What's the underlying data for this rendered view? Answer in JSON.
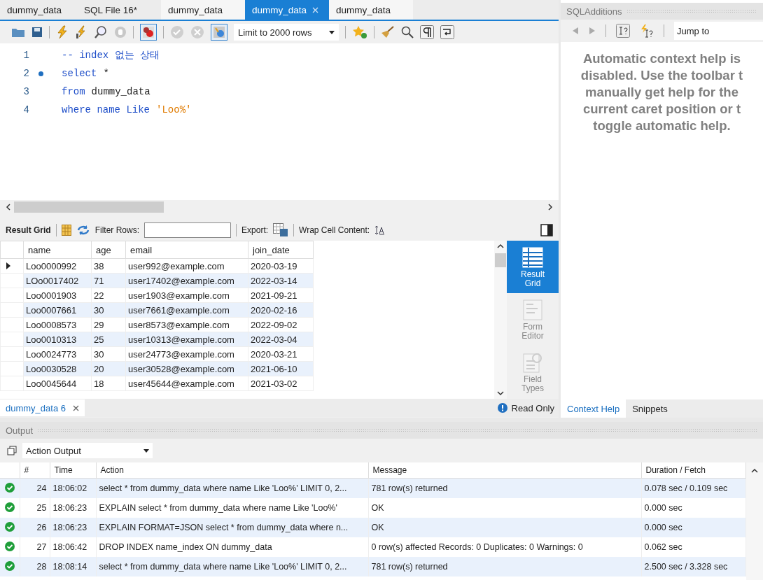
{
  "editor_tabs": [
    {
      "label": "dummy_data",
      "selected": false
    },
    {
      "label": "SQL File 16*",
      "selected": false
    },
    {
      "label": "dummy_data",
      "selected": false
    },
    {
      "label": "dummy_data",
      "selected": true
    },
    {
      "label": "dummy_data",
      "selected": false
    }
  ],
  "toolbar": {
    "limit": "Limit to 2000 rows"
  },
  "editor": {
    "lines": [
      {
        "number": "1",
        "current": false,
        "tokens": [
          {
            "kind": "comment",
            "text": "-- index 없는 상태"
          }
        ]
      },
      {
        "number": "2",
        "current": true,
        "tokens": [
          {
            "kind": "keyword",
            "text": "select"
          },
          {
            "kind": "plain",
            "text": "*"
          }
        ]
      },
      {
        "number": "3",
        "current": false,
        "tokens": [
          {
            "kind": "keyword",
            "text": "from"
          },
          {
            "kind": "plain",
            "text": "dummy_data"
          }
        ]
      },
      {
        "number": "4",
        "current": false,
        "tokens": [
          {
            "kind": "keyword",
            "text": "where name Like"
          },
          {
            "kind": "string",
            "text": "'Loo%'"
          }
        ]
      }
    ]
  },
  "result_toolbar": {
    "grid_label": "Result Grid",
    "filter_label": "Filter Rows:",
    "export_label": "Export:",
    "wrap_label": "Wrap Cell Content:"
  },
  "grid": {
    "columns": [
      "name",
      "age",
      "email",
      "join_date"
    ],
    "rows": [
      {
        "selected": true,
        "cells": [
          "Loo0000992",
          "38",
          "user992@example.com",
          "2020-03-19"
        ]
      },
      {
        "selected": false,
        "cells": [
          "LOo0017402",
          "71",
          "user17402@example.com",
          "2022-03-14"
        ]
      },
      {
        "selected": false,
        "cells": [
          "Loo0001903",
          "22",
          "user1903@example.com",
          "2021-09-21"
        ]
      },
      {
        "selected": false,
        "cells": [
          "Loo0007661",
          "30",
          "user7661@example.com",
          "2020-02-16"
        ]
      },
      {
        "selected": false,
        "cells": [
          "Loo0008573",
          "29",
          "user8573@example.com",
          "2022-09-02"
        ]
      },
      {
        "selected": false,
        "cells": [
          "Loo0010313",
          "25",
          "user10313@example.com",
          "2022-03-04"
        ]
      },
      {
        "selected": false,
        "cells": [
          "Loo0024773",
          "30",
          "user24773@example.com",
          "2020-03-21"
        ]
      },
      {
        "selected": false,
        "cells": [
          "Loo0030528",
          "20",
          "user30528@example.com",
          "2021-06-10"
        ]
      },
      {
        "selected": false,
        "cells": [
          "Loo0045644",
          "18",
          "user45644@example.com",
          "2021-03-02"
        ]
      }
    ]
  },
  "view_panel": [
    {
      "label": "Result Grid",
      "kind": "grid",
      "selected": true
    },
    {
      "label": "Form Editor",
      "kind": "form",
      "selected": false
    },
    {
      "label": "Field Types",
      "kind": "types",
      "selected": false
    }
  ],
  "result_tab": {
    "label": "dummy_data 6",
    "status": "Read Only"
  },
  "sql_additions": {
    "title": "SQLAdditions",
    "jump": "Jump to",
    "help_lines": [
      "Automatic context help is",
      "disabled. Use the toolbar t",
      "manually get help for the",
      "current caret position or t",
      "toggle automatic help."
    ],
    "tabs": [
      {
        "label": "Context Help",
        "selected": true
      },
      {
        "label": "Snippets",
        "selected": false
      }
    ]
  },
  "output": {
    "title": "Output",
    "selector": "Action Output",
    "columns": [
      "#",
      "Time",
      "Action",
      "Message",
      "Duration / Fetch"
    ],
    "rows": [
      {
        "number": "24",
        "time": "18:06:02",
        "action": "select * from dummy_data where name Like 'Loo%' LIMIT 0, 2...",
        "message": "781 row(s) returned",
        "duration": "0.078 sec / 0.109 sec"
      },
      {
        "number": "25",
        "time": "18:06:23",
        "action": "EXPLAIN select * from dummy_data where name Like 'Loo%'",
        "message": "OK",
        "duration": "0.000 sec"
      },
      {
        "number": "26",
        "time": "18:06:23",
        "action": "EXPLAIN FORMAT=JSON select * from dummy_data where n...",
        "message": "OK",
        "duration": "0.000 sec"
      },
      {
        "number": "27",
        "time": "18:06:42",
        "action": "DROP INDEX name_index ON dummy_data",
        "message": "0 row(s) affected Records: 0  Duplicates: 0  Warnings: 0",
        "duration": "0.062 sec"
      },
      {
        "number": "28",
        "time": "18:08:14",
        "action": "select * from dummy_data where name Like 'Loo%' LIMIT 0, 2...",
        "message": "781 row(s) returned",
        "duration": "2.500 sec / 3.328 sec"
      }
    ]
  }
}
